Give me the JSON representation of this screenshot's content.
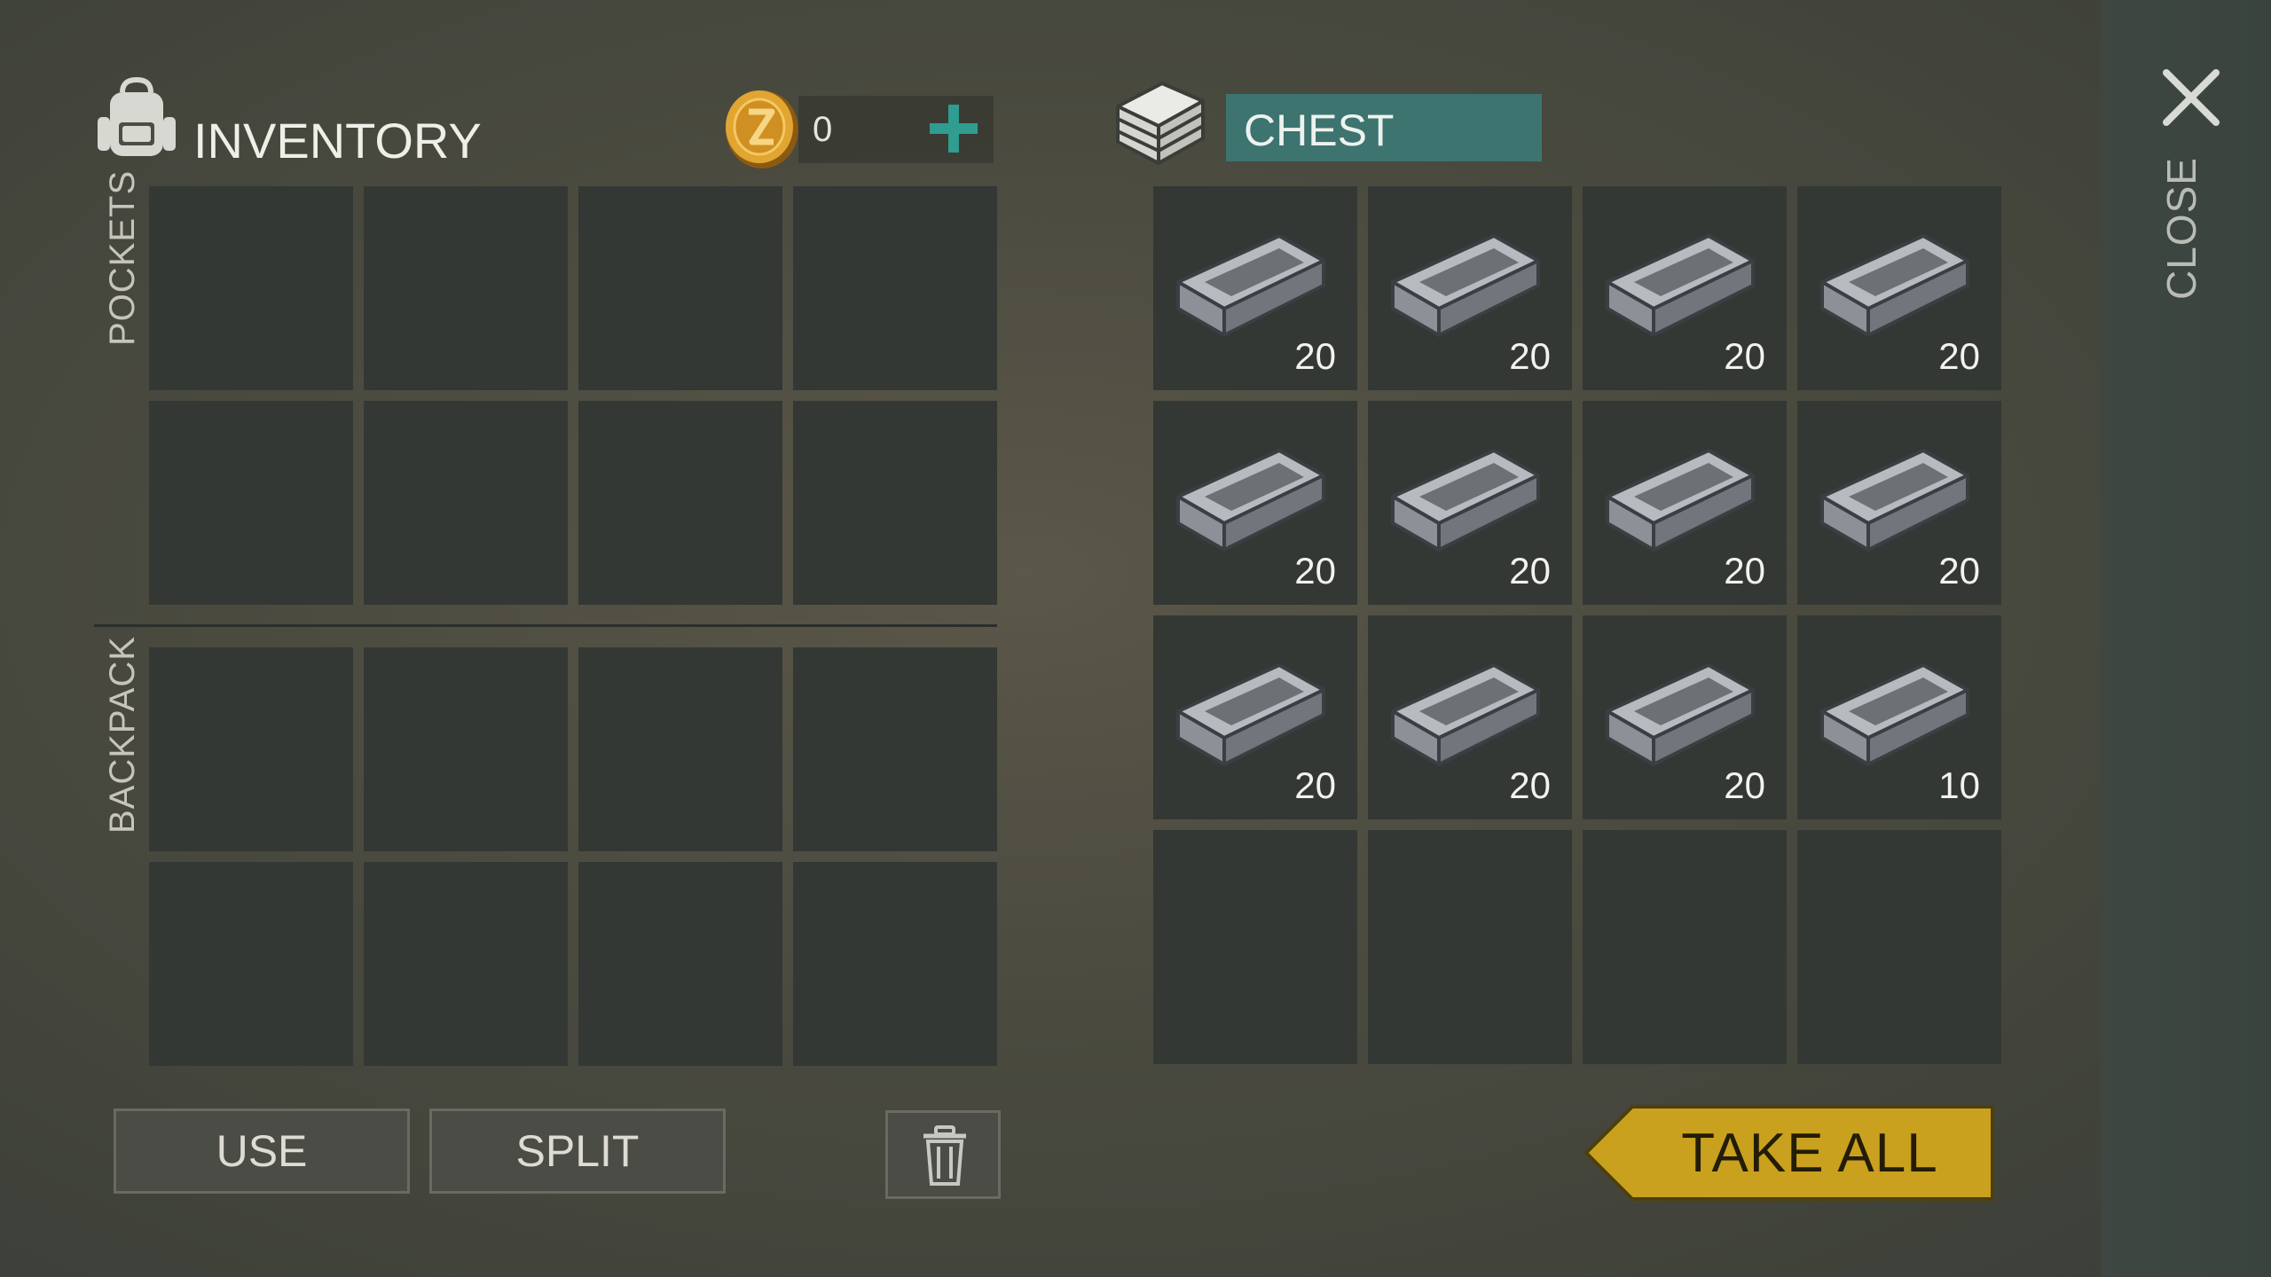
{
  "inventory": {
    "title": "INVENTORY",
    "coins": "0"
  },
  "sections": {
    "pockets": "POCKETS",
    "backpack": "BACKPACK"
  },
  "chest": {
    "name": "CHEST",
    "items": [
      {
        "icon": "metal-ingot-icon",
        "qty": "20"
      },
      {
        "icon": "metal-ingot-icon",
        "qty": "20"
      },
      {
        "icon": "metal-ingot-icon",
        "qty": "20"
      },
      {
        "icon": "metal-ingot-icon",
        "qty": "20"
      },
      {
        "icon": "metal-ingot-icon",
        "qty": "20"
      },
      {
        "icon": "metal-ingot-icon",
        "qty": "20"
      },
      {
        "icon": "metal-ingot-icon",
        "qty": "20"
      },
      {
        "icon": "metal-ingot-icon",
        "qty": "20"
      },
      {
        "icon": "metal-ingot-icon",
        "qty": "20"
      },
      {
        "icon": "metal-ingot-icon",
        "qty": "20"
      },
      {
        "icon": "metal-ingot-icon",
        "qty": "20"
      },
      {
        "icon": "metal-ingot-icon",
        "qty": "10"
      }
    ]
  },
  "buttons": {
    "use": "USE",
    "split": "SPLIT",
    "take_all": "TAKE ALL",
    "close": "CLOSE"
  },
  "colors": {
    "chest_field": "#3d7470",
    "take_all": "#c9a11f",
    "plus": "#2f9d8f",
    "slot": "#343834"
  }
}
